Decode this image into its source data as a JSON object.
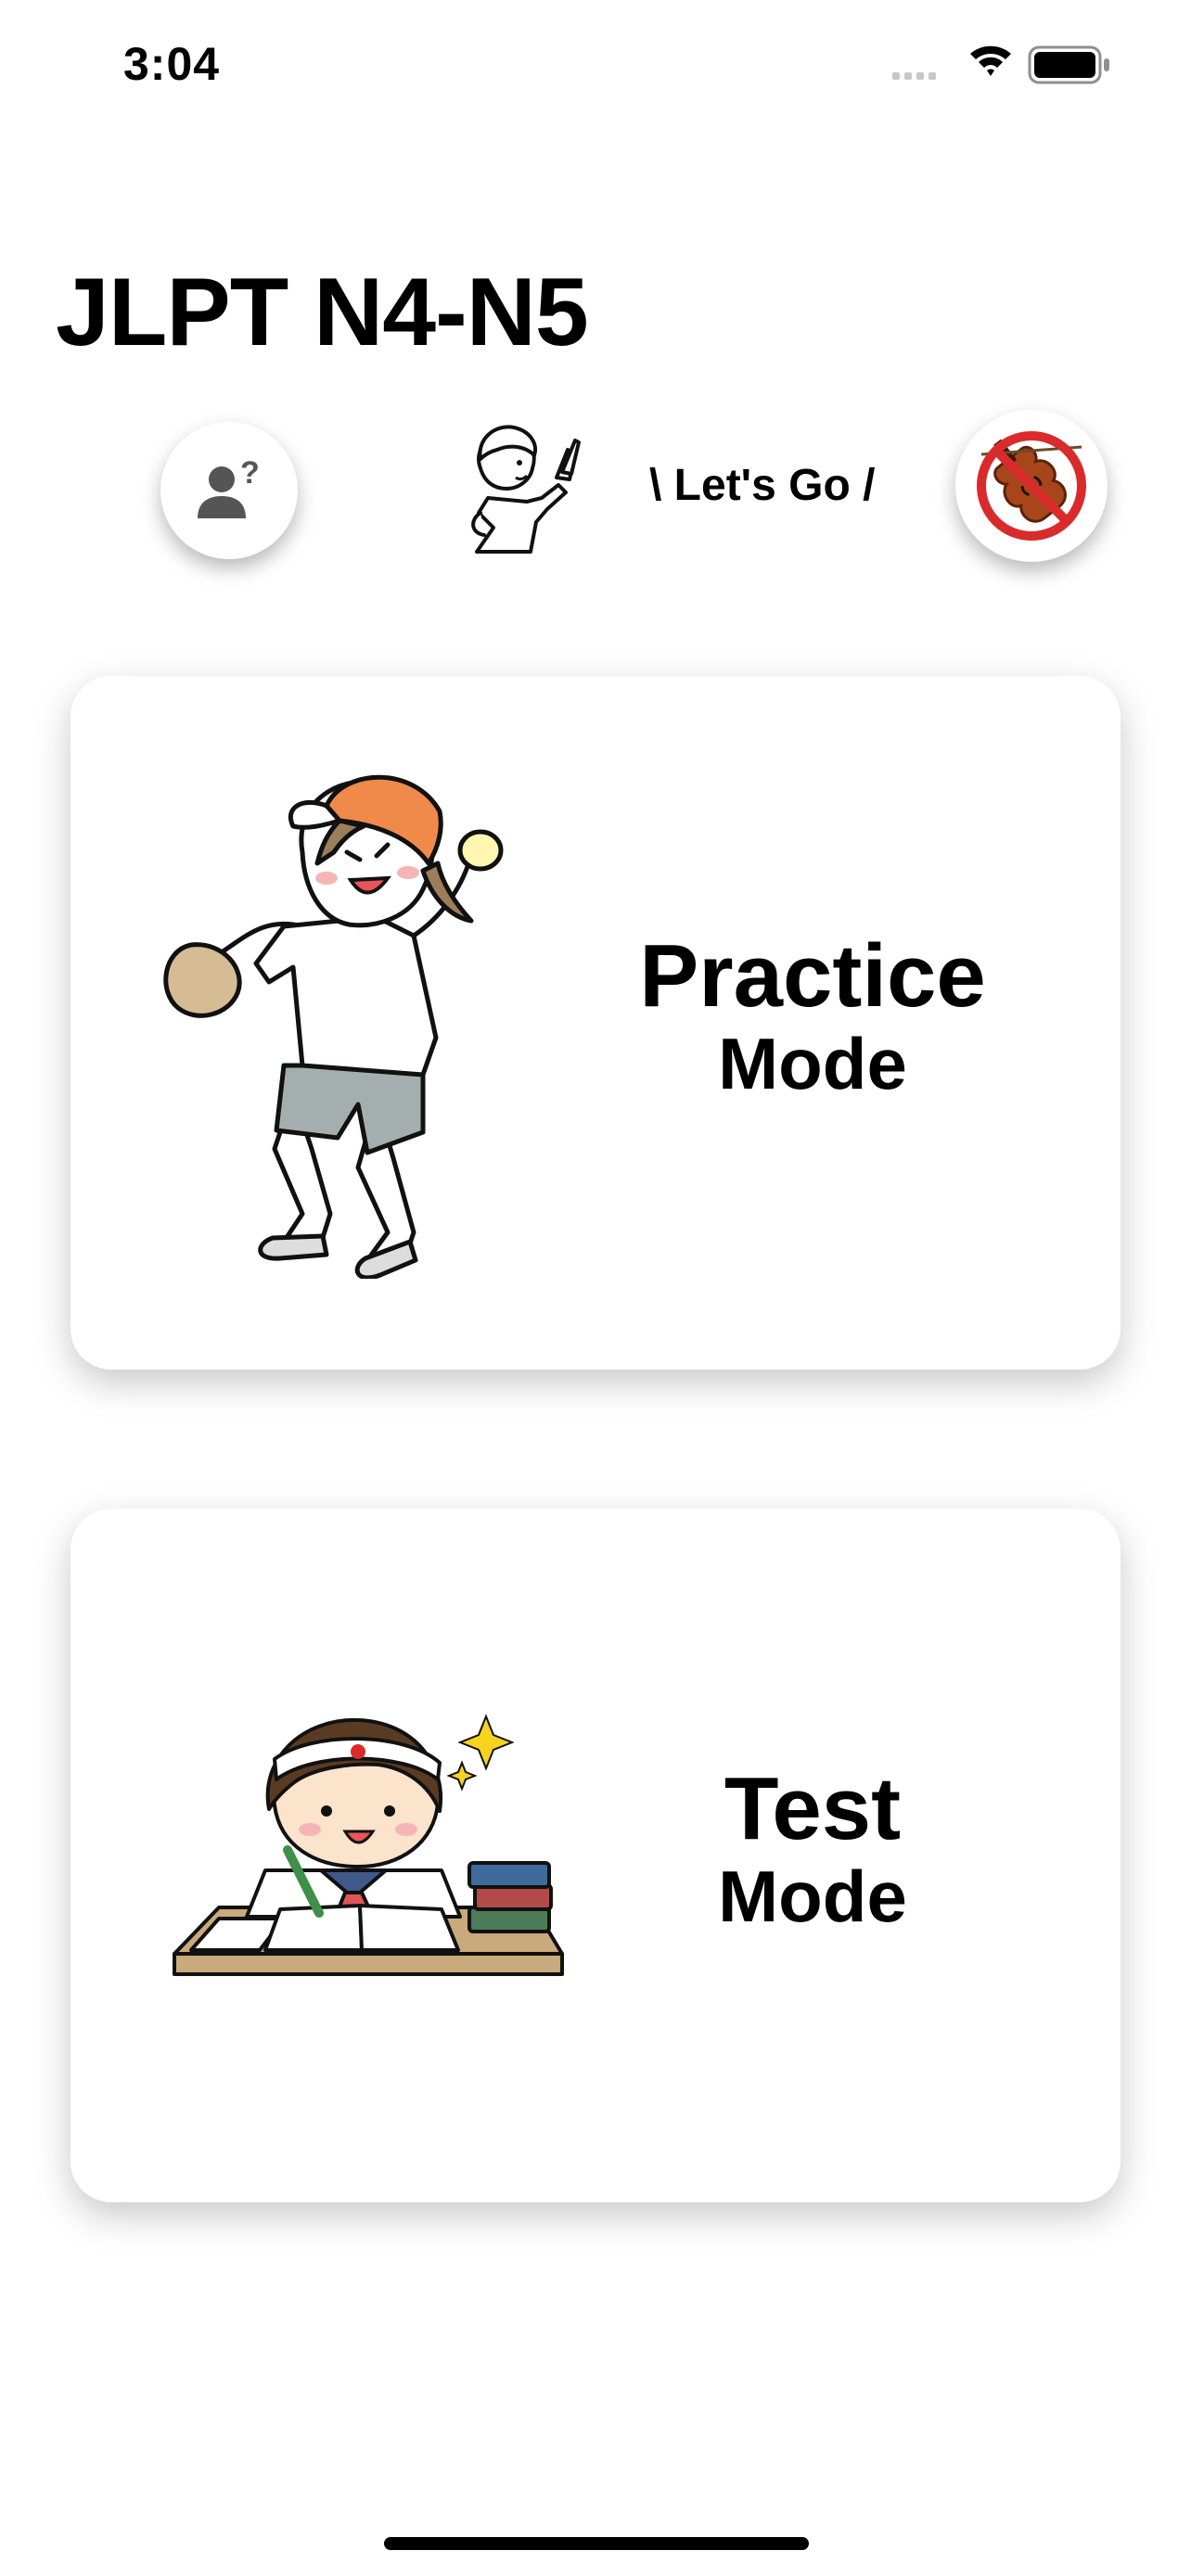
{
  "status_bar": {
    "time": "3:04",
    "icons": [
      "cellular-signal-icon",
      "wifi-icon",
      "battery-icon"
    ]
  },
  "header": {
    "title": "JLPT N4-N5",
    "help_icon": "person-question-icon",
    "mascot_icon": "pointing-boy-illustration",
    "tagline": "\\ Let's Go /",
    "sound_icon": "no-violin-icon"
  },
  "modes": [
    {
      "id": "practice",
      "title": "Practice",
      "subtitle": "Mode",
      "illustration": "baseball-pitcher-illustration"
    },
    {
      "id": "test",
      "title": "Test",
      "subtitle": "Mode",
      "illustration": "studying-student-illustration"
    }
  ],
  "colors": {
    "background": "#ffffff",
    "text": "#000000",
    "accent_orange": "#f08a4b",
    "prohibit_red": "#d92b2b",
    "desk_tan": "#c9aa7c"
  }
}
